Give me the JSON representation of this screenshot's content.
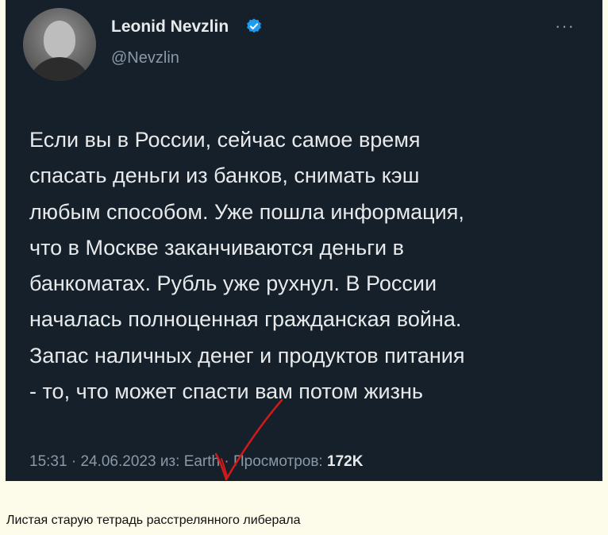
{
  "tweet": {
    "author_name": "Leonid Nevzlin",
    "handle": "@Nevzlin",
    "more_label": "···",
    "text_lines": [
      "Если вы в России, сейчас самое время",
      "спасать деньги из банков, снимать кэш",
      "любым способом. Уже пошла информация,",
      "что в Москве заканчиваются деньги в",
      "банкоматах. Рубль уже рухнул. В России",
      "началась полноценная гражданская война.",
      "Запас наличных денег и продуктов питания",
      "- то, что может спасти вам потом жизнь"
    ],
    "meta": {
      "time": "15:31",
      "separator": " · ",
      "date": "24.06.2023",
      "source": "из: Earth",
      "views_label": "Просмотров: ",
      "views_count": "172K"
    }
  },
  "caption": "Листая старую тетрадь расстрелянного либерала",
  "colors": {
    "card_background": "#15202b",
    "page_background": "#fdfbe9",
    "verified_badge": "#1d9bf0",
    "handwritten_mark": "#d21a1a"
  },
  "icons": {
    "verified": "verified-badge-icon",
    "more": "more-options-icon",
    "mark": "red-checkmark-annotation"
  }
}
